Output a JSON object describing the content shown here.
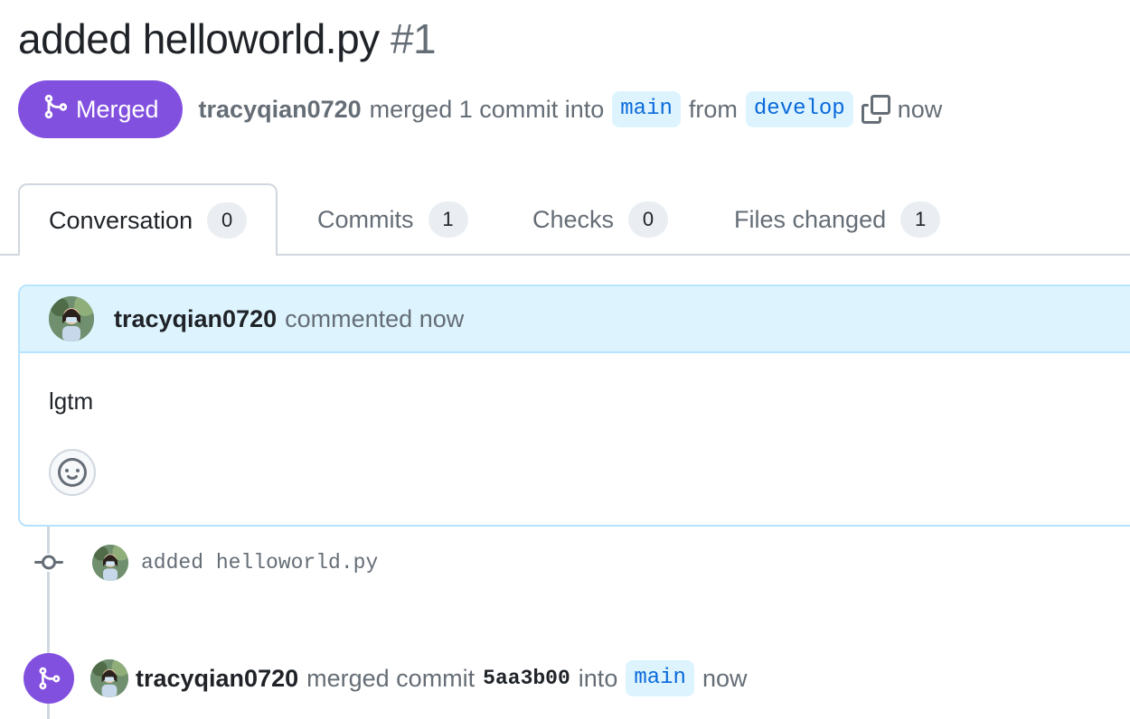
{
  "pull_request": {
    "title": "added helloworld.py",
    "number": "#1"
  },
  "status": {
    "state_label": "Merged",
    "author": "tracyqian0720",
    "merged_text": "merged 1 commit into",
    "base_branch": "main",
    "from_text": "from",
    "head_branch": "develop",
    "time": "now"
  },
  "tabs": [
    {
      "label": "Conversation",
      "count": "0"
    },
    {
      "label": "Commits",
      "count": "1"
    },
    {
      "label": "Checks",
      "count": "0"
    },
    {
      "label": "Files changed",
      "count": "1"
    }
  ],
  "comment": {
    "author": "tracyqian0720",
    "action_text": "commented now",
    "body": "lgtm"
  },
  "commit": {
    "message": "added helloworld.py"
  },
  "merge_event": {
    "author": "tracyqian0720",
    "action_text": "merged commit",
    "sha": "5aa3b00",
    "into_text": "into",
    "branch": "main",
    "time": "now"
  },
  "icons": {
    "merge": "git-merge-icon",
    "copy": "copy-icon",
    "commit": "git-commit-icon",
    "reaction": "smiley-icon"
  },
  "colors": {
    "merged_purple": "#8250df",
    "link_blue": "#0969da",
    "branch_bg": "#ddf4ff",
    "comment_header_bg": "#ddf4ff",
    "muted_text": "#656d76"
  }
}
